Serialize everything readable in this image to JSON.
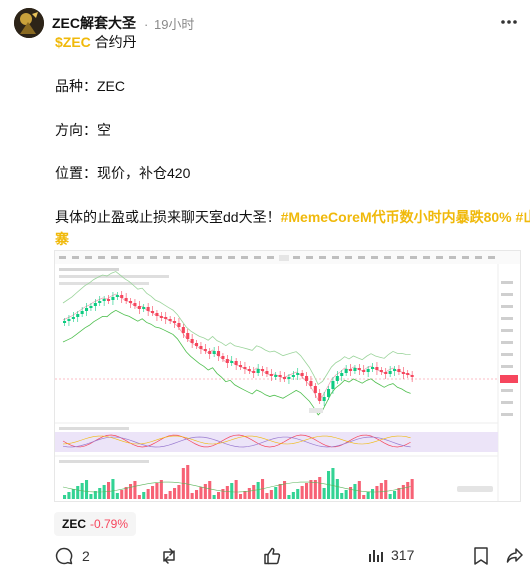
{
  "post": {
    "author": "ZEC解套大圣",
    "time_sep": "·",
    "time": "19小时",
    "ticker": "$ZEC",
    "ticker_suffix": "合约丹",
    "lines": {
      "variety": "品种：ZEC",
      "direction": "方向：空",
      "position": "位置：现价，补仓420"
    },
    "body_text": "具体的止盈或止损来聊天室dd大圣！",
    "hashtag_1": "#MemeCoreM代币数小时内暴跌80%",
    "hashtag_2_line1": "#山",
    "hashtag_2_line2": "寨"
  },
  "price_tag": {
    "symbol": "ZEC",
    "change": "-0.79%"
  },
  "actions": {
    "comments": "2",
    "views": "317"
  },
  "colors": {
    "accent": "#f0b90b",
    "down": "#f6465d",
    "up": "#0ecb81"
  },
  "icons": [
    "more-icon",
    "comment-icon",
    "repost-icon",
    "like-icon",
    "views-icon",
    "bookmark-icon",
    "share-icon"
  ]
}
